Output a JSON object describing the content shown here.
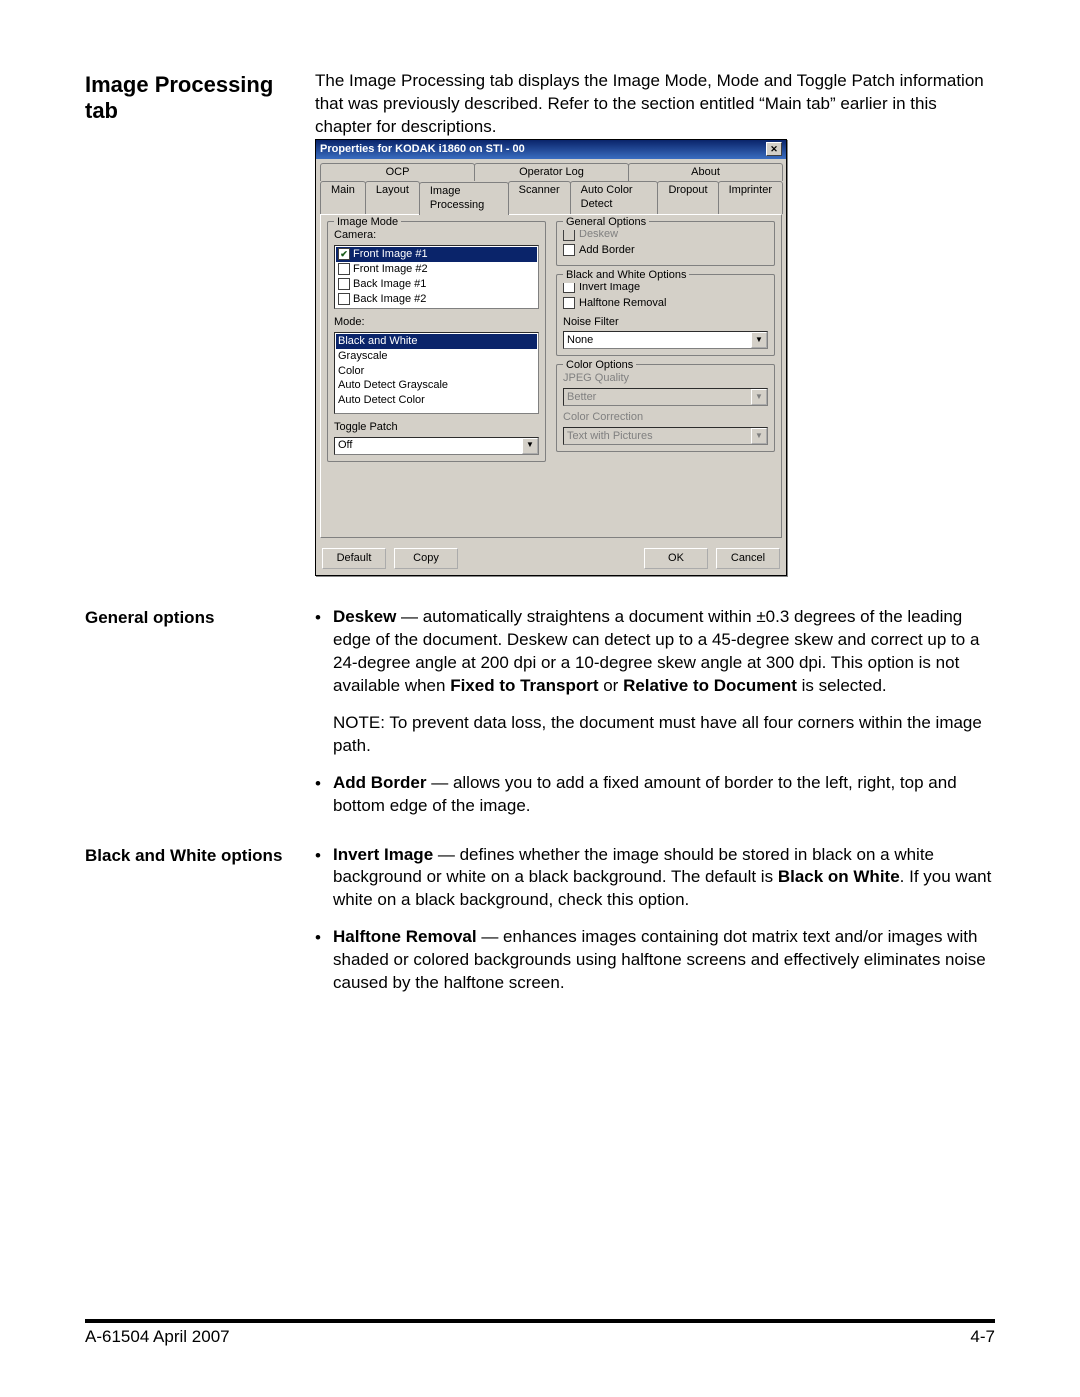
{
  "heading": "Image Processing tab",
  "intro": "The Image Processing tab displays the Image Mode, Mode and Toggle Patch information that was previously described. Refer to the section entitled “Main tab” earlier in this chapter for descriptions.",
  "sections": {
    "general": {
      "title": "General options",
      "b1_lead": "Deskew",
      "b1_text": " — automatically straightens a document within ±0.3 degrees of the leading edge of the document. Deskew can detect up to a 45-degree skew and correct up to a 24-degree angle at 200 dpi or a 10-degree skew angle at 300 dpi. This option is not available when ",
      "b1_bold2": "Fixed to Transport",
      "b1_mid": " or ",
      "b1_bold3": "Relative to Document",
      "b1_tail": " is selected.",
      "note": "NOTE: To prevent data loss, the document must have all four corners within the image path.",
      "b2_lead": "Add Border",
      "b2_text": " — allows you to add a fixed amount of border to the left, right, top and bottom edge of the image."
    },
    "bw": {
      "title": "Black and White options",
      "b1_lead": "Invert Image",
      "b1_text": " — defines whether the image should be stored in black on a white background or white on a black background. The default is ",
      "b1_bold2": "Black on White",
      "b1_tail": ". If you want white on a black background, check this option.",
      "b2_lead": "Halftone Removal",
      "b2_text": " — enhances images containing dot matrix text and/or images with shaded or colored backgrounds using halftone screens and effectively eliminates noise caused by the halftone screen."
    }
  },
  "dialog": {
    "title": "Properties for KODAK i1860 on STI - 00",
    "tabs_row1": [
      "OCP",
      "Operator Log",
      "About"
    ],
    "tabs_row2": [
      "Main",
      "Layout",
      "Image Processing",
      "Scanner",
      "Auto Color Detect",
      "Dropout",
      "Imprinter"
    ],
    "active_tab": "Image Processing",
    "image_mode": {
      "legend": "Image Mode",
      "camera_label": "Camera:",
      "items": [
        "Front Image #1",
        "Front Image #2",
        "Back Image #1",
        "Back Image #2"
      ],
      "checked": "Front Image #1",
      "mode_label": "Mode:",
      "modes": [
        "Black and White",
        "Grayscale",
        "Color",
        "Auto Detect Grayscale",
        "Auto Detect Color"
      ],
      "mode_selected": "Black and White",
      "toggle_label": "Toggle Patch",
      "toggle_value": "Off"
    },
    "general_options": {
      "legend": "General Options",
      "deskew": "Deskew",
      "add_border": "Add Border"
    },
    "bw_options": {
      "legend": "Black and White Options",
      "invert": "Invert Image",
      "halftone": "Halftone Removal",
      "noise_label": "Noise Filter",
      "noise_value": "None"
    },
    "color_options": {
      "legend": "Color Options",
      "jpeg_label": "JPEG Quality",
      "jpeg_value": "Better",
      "corr_label": "Color Correction",
      "corr_value": "Text with Pictures"
    },
    "buttons": {
      "default": "Default",
      "copy": "Copy",
      "ok": "OK",
      "cancel": "Cancel"
    }
  },
  "footer": {
    "left": "A-61504   April 2007",
    "right": "4-7"
  }
}
